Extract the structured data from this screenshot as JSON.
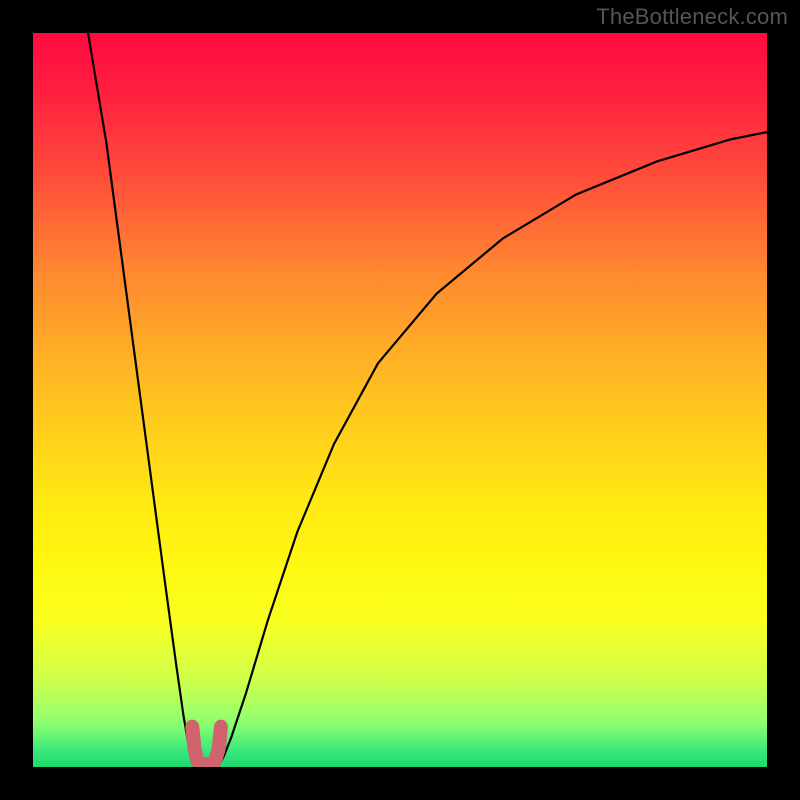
{
  "watermark": "TheBottleneck.com",
  "chart_data": {
    "type": "line",
    "title": "",
    "xlabel": "",
    "ylabel": "",
    "xlim": [
      0,
      100
    ],
    "ylim": [
      0,
      100
    ],
    "grid": false,
    "legend": false,
    "background_gradient": {
      "direction": "vertical",
      "stops": [
        {
          "pos": 0,
          "color": "#ff0a3f"
        },
        {
          "pos": 50,
          "color": "#ffd11c"
        },
        {
          "pos": 80,
          "color": "#fbff18"
        },
        {
          "pos": 100,
          "color": "#26df72"
        }
      ]
    },
    "series": [
      {
        "name": "bottleneck-curve-left",
        "color": "#000000",
        "stroke_width": 2,
        "x": [
          7.5,
          10,
          12,
          14,
          16,
          18,
          19.5,
          20.5,
          21.2,
          21.8,
          22.3
        ],
        "y": [
          100,
          85,
          70,
          55,
          40,
          25,
          14,
          7,
          3,
          1.2,
          0.5
        ]
      },
      {
        "name": "bottleneck-curve-right",
        "color": "#000000",
        "stroke_width": 2,
        "x": [
          25.5,
          26,
          27,
          29,
          32,
          36,
          41,
          47,
          55,
          64,
          74,
          85,
          95,
          100
        ],
        "y": [
          0.5,
          1.5,
          4,
          10,
          20,
          32,
          44,
          55,
          64.5,
          72,
          78,
          82.5,
          85.5,
          86.5
        ]
      },
      {
        "name": "sweet-spot-band",
        "color": "#d0636b",
        "stroke_width": 10,
        "x": [
          21.7,
          22.0,
          22.4,
          23.0,
          24.0,
          24.8,
          25.3,
          25.6
        ],
        "y": [
          5.5,
          2.5,
          0.8,
          0.4,
          0.4,
          0.8,
          2.5,
          5.5
        ]
      }
    ]
  }
}
